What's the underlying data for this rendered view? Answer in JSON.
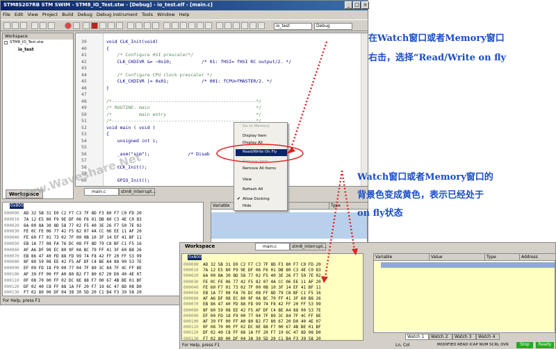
{
  "main": {
    "title": "STM8S207RB STM SWIM - STM8_IO_Test.stw - [Debug] - io_test.elf - [main.c]",
    "win_buttons": [
      "_",
      "□",
      "×"
    ],
    "menu": [
      "File",
      "Edit",
      "View",
      "Project",
      "Build",
      "Debug",
      "Debug instrument",
      "Tools",
      "Window",
      "Help"
    ],
    "combo_project": "io_test",
    "combo_config": "Debug",
    "workspace": {
      "title": "Workspace",
      "root": "STM8_IO_Test.stw",
      "child": "io_test",
      "tab": "Workspace"
    },
    "editor_tabs": [
      "main.c",
      "stm8_interrupt..."
    ],
    "code": [
      {
        "n": "39",
        "t": "void CLK_Init(void)"
      },
      {
        "n": "40",
        "t": "{"
      },
      {
        "n": "41",
        "t": "    /* Configure HSI prescaler*/",
        "c": true
      },
      {
        "n": "42",
        "t": "    CLK_CKDIVR &= ~0x10;           /* 01: fHSI= fHSI RC output/2. */"
      },
      {
        "n": "43",
        "t": ""
      },
      {
        "n": "44",
        "t": "    /* Configure CPU clock prescaler */",
        "c": true
      },
      {
        "n": "45",
        "t": "    CLK_CKDIVR |= 0x01;            /* 001: fCPU=fMASTER/2. */"
      },
      {
        "n": "46",
        "t": "}"
      },
      {
        "n": "47",
        "t": ""
      },
      {
        "n": "48",
        "t": "/*-----------------------------------------------------*/",
        "c": true
      },
      {
        "n": "49",
        "t": "/* ROUTINE: main                                       */",
        "c": true
      },
      {
        "n": "50",
        "t": "/*          main entry                                 */",
        "c": true
      },
      {
        "n": "51",
        "t": "/*-----------------------------------------------------*/",
        "c": true
      },
      {
        "n": "52",
        "t": "void main ( void )"
      },
      {
        "n": "53",
        "t": "{"
      },
      {
        "n": "54",
        "t": "    unsigned int i;"
      },
      {
        "n": "55",
        "t": ""
      },
      {
        "n": "56",
        "t": "    _asm(\"sim\");              /* Disab"
      },
      {
        "n": "57",
        "t": ""
      },
      {
        "n": "58",
        "t": "    CLK_Init();"
      },
      {
        "n": "59",
        "t": ""
      },
      {
        "n": "60",
        "t": "    GPIO_Init();"
      }
    ],
    "context_menu": [
      "Go to Memory",
      "Display Item",
      "Display All",
      "Read/Write On Fly",
      "Remove Item",
      "Remove All Items",
      "View",
      "Refresh All",
      "Allow Docking",
      "Hide"
    ],
    "memory": {
      "address_field": "0x800",
      "addrs": [
        "000000",
        "000010",
        "000020",
        "000030",
        "000040",
        "000050",
        "000060",
        "000070",
        "000080",
        "000090",
        "000100",
        "000110",
        "000120",
        "000130"
      ],
      "rows": [
        "AD 32 5B 31 E0 C2 F7 C3 7F 8D F3 80 F7 C0 FD 20",
        "7A 12 E5 80 F9 9E DF 06 F6 01 DB 80 C3 4E C0 83",
        "6A 00 8A 30 8D 58 77 02 F5 40 3E 26 F7 50 7E 02",
        "FE 0C FE 06 77 42 F5 82 07 4A CC 06 EE 11 AF 20",
        "FE 60 F7 01 73 02 7F 00 0B 10 3F 14 EF 41 BF 11",
        "EB 1A 77 08 FA 76 DC 08 FF 8D 79 C8 BF C1 F5 16",
        "AF A6 DF 98 EC 80 9F 0A BC 79 FF 41 3F 60 B8 26",
        "EB 86 47 40 FD 88 FD 99 74 F8 42 FF 20 FF 53 99",
        "8F 80 59 08 EE 42 F5 AF DF C4 BE A4 88 90 53 7E",
        "EF 09 FD 18 F9 00 77 04 7F 89 3C 84 7F 4C FF 8E",
        "AF 39 FF 00 FF A0 80 B2 F7 80 67 20 D0 40 4E 07",
        "0F 08 70 00 FF 02 DC 8E 88 F7 00 67 4B BE 01 BF",
        "DF 02 40 C8 FF 88 1A FF 20 F7 19 6C 47 8D 08 D0",
        "F7 02 80 00 DF 04 38 30 5D 20 C1 B4 F3 39 58 20"
      ]
    },
    "watch_cols": [
      "Variable",
      "Value",
      "Type",
      "Address"
    ],
    "watch_tabs": [
      "Watch 1",
      "Watch 2",
      "Watch 3",
      "Watch 4"
    ],
    "status": "For Help, press F1",
    "status2": [
      "Ln, Col",
      "MODIFIED READ ICAP NUM SCRL OVR",
      "Stop",
      "Ready"
    ],
    "watermark": "www.Waveshare.Net"
  },
  "notes": {
    "note1_line1": "在Watch窗口或者Memory窗口",
    "note1_line2": "右击，选择“Read/Write on fly",
    "note2_line1": "Watch窗口或者Memory窗口的",
    "note2_line2": "背景色变成黄色，表示已经处于",
    "note2_line3": "on fly状态"
  },
  "colors": {
    "title_bar": "#0a246a",
    "annotation_text": "#1a4dc8",
    "arrow": "#e02020",
    "highlight": "#f8f8b0",
    "ellipse": "#e02020",
    "memory_yellow": "#ffffc0"
  }
}
